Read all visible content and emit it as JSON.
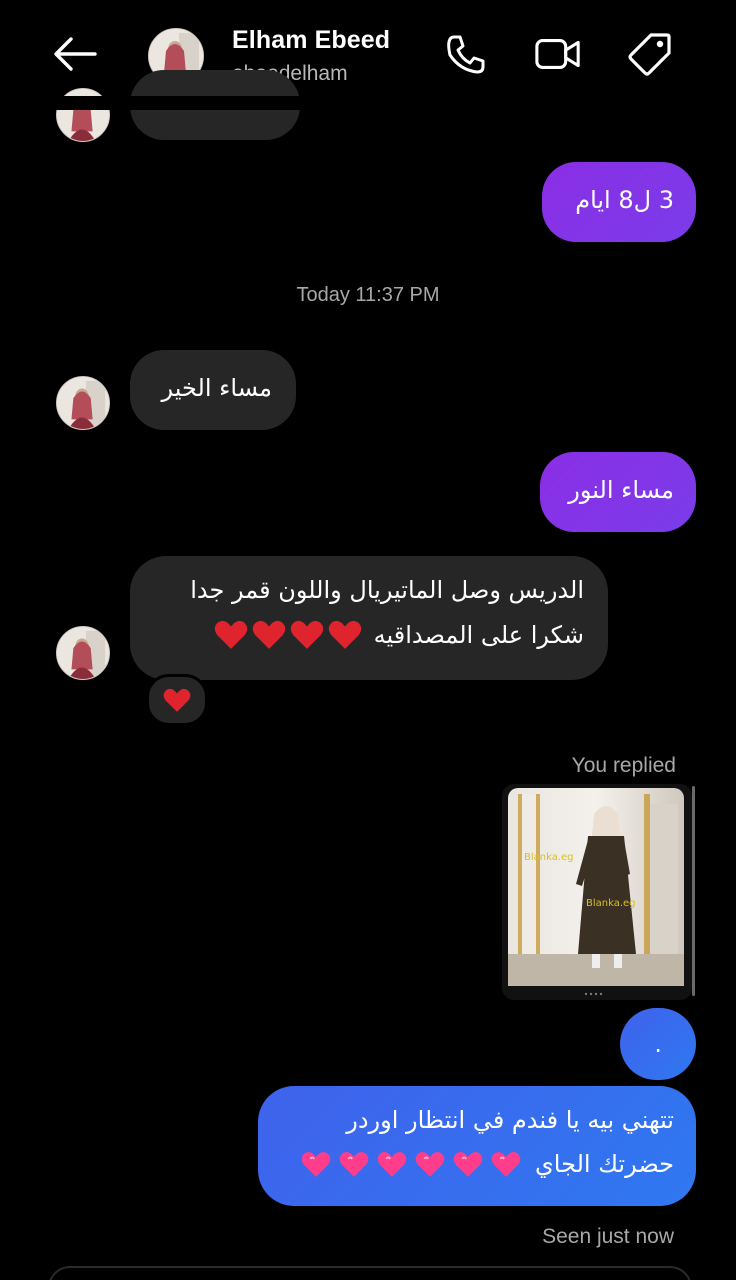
{
  "header": {
    "name": "Elham Ebeed",
    "username": "ebeedelham",
    "icons": [
      "back-arrow-icon",
      "phone-icon",
      "video-camera-icon",
      "tag-icon"
    ]
  },
  "messages": {
    "out_days": "3 ل8 ايام",
    "timestamp": "Today 11:37 PM",
    "in_greeting": "مساء الخير",
    "out_reply": "مساء النور",
    "in_long_line1": "الدريس وصل الماتيريال واللون قمر جدا",
    "in_long_line2": "شكرا على المصداقيه",
    "you_replied": "You replied",
    "dot_message": ".",
    "out_long_line1": "تتهني بيه يا فندم في انتظار اوردر",
    "out_long_line2": "حضرتك الجاي",
    "seen": "Seen just now"
  },
  "photo": {
    "watermark1": "Blanka.eg",
    "watermark2": "Blanka.eg"
  },
  "colors": {
    "purple_bubble": "#8b2ee6",
    "blue_bubble": "#3a6cee",
    "incoming_bubble": "#262626",
    "red_heart": "#e0242e",
    "pink_heart": "#ff3d8b"
  }
}
